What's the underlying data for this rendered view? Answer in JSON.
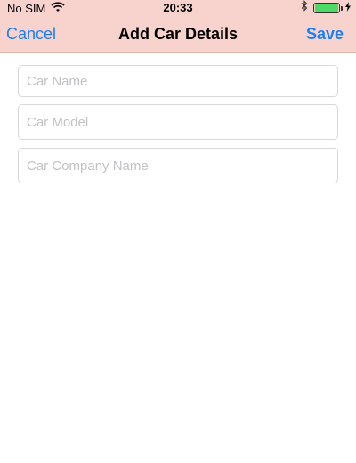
{
  "status_bar": {
    "carrier": "No SIM",
    "time": "20:33",
    "battery_level": 1.0
  },
  "nav": {
    "cancel_label": "Cancel",
    "title": "Add Car Details",
    "save_label": "Save"
  },
  "form": {
    "car_name": {
      "value": "",
      "placeholder": "Car Name"
    },
    "car_model": {
      "value": "",
      "placeholder": "Car Model"
    },
    "car_company": {
      "value": "",
      "placeholder": "Car Company Name"
    }
  },
  "colors": {
    "nav_background": "#f8d2cc",
    "accent": "#1a7ff2",
    "battery": "#4cd964"
  },
  "icons": [
    "wifi-icon",
    "bluetooth-icon",
    "battery-icon",
    "charging-bolt-icon"
  ]
}
